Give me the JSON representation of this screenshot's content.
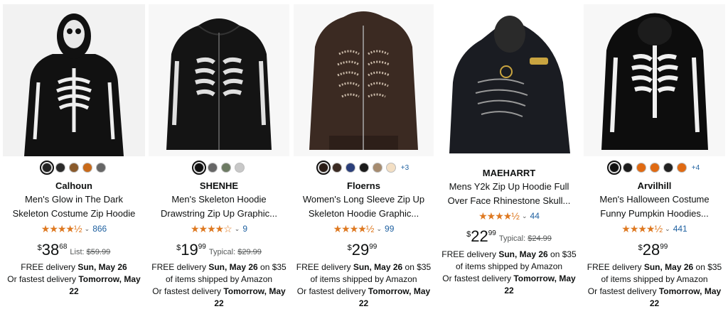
{
  "products": [
    {
      "brand": "Calhoun",
      "title_line1": "Men's Glow in The Dark",
      "title_line2": "Skeleton Costume Zip Hoodie",
      "stars": "★★★★½",
      "rating_count": "866",
      "price_symbol": "$",
      "price_whole": "38",
      "price_fraction": "68",
      "ref_label": "List:",
      "ref_price": "$59.99",
      "delivery_prefix": "FREE delivery",
      "delivery_date": "Sun, May 26",
      "delivery_suffix": "",
      "delivery_line2": "",
      "fastest_prefix": "Or fastest delivery",
      "fastest_date": "Tomorrow, May 22",
      "swatch_colors": [
        "#222222",
        "#2b2b2b",
        "#8a5a2b",
        "#c96a1a",
        "#666666"
      ],
      "swatch_more": "",
      "image_bg": "#f2f2f2"
    },
    {
      "brand": "SHENHE",
      "title_line1": "Men's Skeleton Hoodie",
      "title_line2": "Drawstring Zip Up Graphic...",
      "stars": "★★★★☆",
      "rating_count": "9",
      "price_symbol": "$",
      "price_whole": "19",
      "price_fraction": "99",
      "ref_label": "Typical:",
      "ref_price": "$29.99",
      "delivery_prefix": "FREE delivery",
      "delivery_date": "Sun, May 26",
      "delivery_suffix": "on $35",
      "delivery_line2": "of items shipped by Amazon",
      "fastest_prefix": "Or fastest delivery",
      "fastest_date": "Tomorrow, May 22",
      "swatch_colors": [
        "#111111",
        "#666666",
        "#6d7b63",
        "#c8c8c8"
      ],
      "swatch_more": "",
      "image_bg": "#ffffff"
    },
    {
      "brand": "Floerns",
      "title_line1": "Women's Long Sleeve Zip Up",
      "title_line2": "Skeleton Hoodie Graphic...",
      "stars": "★★★★½",
      "rating_count": "99",
      "price_symbol": "$",
      "price_whole": "29",
      "price_fraction": "99",
      "ref_label": "",
      "ref_price": "",
      "delivery_prefix": "FREE delivery",
      "delivery_date": "Sun, May 26",
      "delivery_suffix": "on $35",
      "delivery_line2": "of items shipped by Amazon",
      "fastest_prefix": "Or fastest delivery",
      "fastest_date": "Tomorrow, May 22",
      "swatch_colors": [
        "#2a1d17",
        "#3b2a22",
        "#2b3f7a",
        "#1b1b1b",
        "#a68b6f",
        "#f3dfc4"
      ],
      "swatch_more": "+3",
      "image_bg": "#ffffff"
    },
    {
      "brand": "MAEHARRT",
      "title_line1": "Mens Y2k Zip Up Hoodie Full",
      "title_line2": "Over Face Rhinestone Skull...",
      "stars": "★★★★½",
      "rating_count": "44",
      "price_symbol": "$",
      "price_whole": "22",
      "price_fraction": "99",
      "ref_label": "Typical:",
      "ref_price": "$24.99",
      "delivery_prefix": "FREE delivery",
      "delivery_date": "Sun, May 26",
      "delivery_suffix": "on $35",
      "delivery_line2": "of items shipped by Amazon",
      "fastest_prefix": "Or fastest delivery",
      "fastest_date": "Tomorrow, May 22",
      "swatch_colors": [],
      "swatch_more": "",
      "image_bg": "#ffffff"
    },
    {
      "brand": "Arvilhill",
      "title_line1": "Men's Halloween Costume",
      "title_line2": "Funny Pumpkin Hoodies...",
      "stars": "★★★★½",
      "rating_count": "441",
      "price_symbol": "$",
      "price_whole": "28",
      "price_fraction": "99",
      "ref_label": "",
      "ref_price": "",
      "delivery_prefix": "FREE delivery",
      "delivery_date": "Sun, May 26",
      "delivery_suffix": "on $35",
      "delivery_line2": "of items shipped by Amazon",
      "fastest_prefix": "Or fastest delivery",
      "fastest_date": "Tomorrow, May 22",
      "swatch_colors": [
        "#111111",
        "#1d1d1d",
        "#e06a12",
        "#e06a12",
        "#222222",
        "#e06a12"
      ],
      "swatch_more": "+4",
      "image_bg": "#ffffff"
    }
  ]
}
